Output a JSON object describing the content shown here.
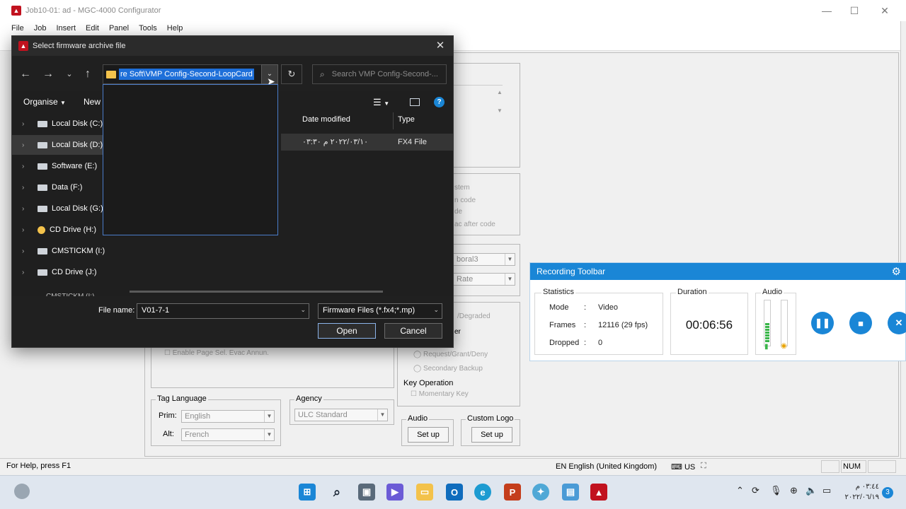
{
  "app": {
    "title": "Job10-01: ad - MGC-4000 Configurator",
    "menu": [
      "File",
      "Job",
      "Insert",
      "Edit",
      "Panel",
      "Tools",
      "Help"
    ]
  },
  "background_panel": {
    "muted_items": [
      "stem",
      "n code",
      "de",
      "ac after code"
    ],
    "combo1": "boral3",
    "combo2": "Rate",
    "degraded": "/Degraded",
    "er_label": "er",
    "enable_text": "Enable Page Sel. Evac Annun.",
    "request_text": "Request/Grant/Deny",
    "secondary_backup": "Secondary Backup",
    "key_operation": {
      "label": "Key Operation",
      "option": "Momentary Key"
    },
    "tag_language": {
      "label": "Tag Language",
      "prim_label": "Prim:",
      "prim_value": "English",
      "alt_label": "Alt:",
      "alt_value": "French"
    },
    "agency": {
      "label": "Agency",
      "value": "ULC Standard"
    },
    "audio": {
      "label": "Audio",
      "button": "Set up"
    },
    "custom_logo": {
      "label": "Custom Logo",
      "button": "Set up"
    }
  },
  "statusbar": {
    "help": "For Help, press F1",
    "language": "EN English (United Kingdom)",
    "keyboard": "US",
    "num": "NUM"
  },
  "dialog": {
    "title": "Select firmware archive file",
    "address_path": "re Soft\\VMP Config-Second-LoopCard",
    "search_placeholder": "Search VMP Config-Second-...",
    "organise": "Organise",
    "new_label": "New f",
    "nav_items": [
      {
        "label": "Local Disk (C:)",
        "icon": "system-drive-icon"
      },
      {
        "label": "Local Disk (D:)",
        "icon": "drive-icon"
      },
      {
        "label": "Software (E:)",
        "icon": "drive-icon"
      },
      {
        "label": "Data (F:)",
        "icon": "drive-icon"
      },
      {
        "label": "Local Disk (G:)",
        "icon": "drive-icon"
      },
      {
        "label": "CD Drive (H:)",
        "icon": "cd-icon"
      },
      {
        "label": "CMSTICKM (I:)",
        "icon": "usb-drive-icon"
      },
      {
        "label": "CD Drive (J:)",
        "icon": "cd-drive-icon"
      }
    ],
    "nav_partial": "CMSTICKM (I:)",
    "columns": [
      "Date modified",
      "Type"
    ],
    "row": {
      "date": "٢٠٢٢/٠٣/١٠ م ٠٣:٣٠",
      "type": "FX4 File"
    },
    "file_name_label": "File name:",
    "file_name_value": "V01-7-1",
    "filter_value": "Firmware Files (*.fx4;*.mp)",
    "open_label": "Open",
    "cancel_label": "Cancel"
  },
  "recording": {
    "title": "Recording Toolbar",
    "statistics_label": "Statistics",
    "stats": [
      {
        "key": "Mode",
        "value": "Video"
      },
      {
        "key": "Frames",
        "value": "12116 (29 fps)"
      },
      {
        "key": "Dropped",
        "value": "0"
      }
    ],
    "duration_label": "Duration",
    "duration_value": "00:06:56",
    "audio_label": "Audio",
    "colors": {
      "accent": "#1a86d6"
    }
  },
  "taskbar": {
    "time": "٠٣:٤٤ م",
    "date": "٢٠٢٢/٠٦/١٩",
    "notification_count": "3"
  }
}
